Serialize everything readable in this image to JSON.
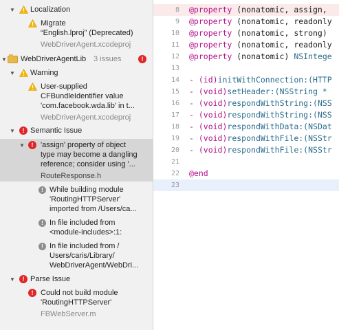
{
  "issue_navigator": {
    "localization_group": {
      "label": "Localization"
    },
    "localization_issue": {
      "line1": "Migrate",
      "line2": "“English.lproj” (Deprecated)",
      "file": "WebDriverAgent.xcodeproj"
    },
    "project": {
      "name": "WebDriverAgentLib",
      "count": "3 issues"
    },
    "warning_group": {
      "label": "Warning"
    },
    "warning_issue": {
      "line1": "User-supplied",
      "line2": "CFBundleIdentifier value",
      "line3": "'com.facebook.wda.lib' in t...",
      "file": "WebDriverAgent.xcodeproj"
    },
    "semantic_group": {
      "label": "Semantic Issue"
    },
    "semantic_issue": {
      "line1": "'assign' property of object",
      "line2": "type may become a dangling",
      "line3": "reference; consider using '...",
      "file": "RouteResponse.h"
    },
    "note1": {
      "line1": "While building module",
      "line2": "'RoutingHTTPServer'",
      "line3": "imported from /Users/ca..."
    },
    "note2": {
      "line1": "In file included from",
      "line2": "<module-includes>:1:"
    },
    "note3": {
      "line1": "In file included from /",
      "line2": "Users/caris/Library/",
      "line3": "WebDriverAgent/WebDri..."
    },
    "parse_group": {
      "label": "Parse Issue"
    },
    "parse_issue": {
      "line1": "Could not build module",
      "line2": "'RoutingHTTPServer'",
      "file": "FBWebServer.m"
    }
  },
  "editor": {
    "lines": [
      {
        "num": "8",
        "kw": "@property",
        "rest": " (nonatomic, assign,"
      },
      {
        "num": "9",
        "kw": "@property",
        "rest": " (nonatomic, readonly"
      },
      {
        "num": "10",
        "kw": "@property",
        "rest": " (nonatomic, strong)"
      },
      {
        "num": "11",
        "kw": "@property",
        "rest": " (nonatomic, readonly"
      },
      {
        "num": "12",
        "kw": "@property",
        "rest": " (nonatomic) ",
        "type": "NSIntege"
      },
      {
        "num": "13",
        "kw": "",
        "rest": ""
      },
      {
        "num": "14",
        "kw": "- ",
        "rest": "(id)",
        "type": "initWithConnection:(HTTP"
      },
      {
        "num": "15",
        "kw": "- ",
        "rest": "(void)",
        "type": "setHeader:(NSString *"
      },
      {
        "num": "16",
        "kw": "- ",
        "rest": "(void)",
        "type": "respondWithString:(NSS"
      },
      {
        "num": "17",
        "kw": "- ",
        "rest": "(void)",
        "type": "respondWithString:(NSS"
      },
      {
        "num": "18",
        "kw": "- ",
        "rest": "(void)",
        "type": "respondWithData:(NSDat"
      },
      {
        "num": "19",
        "kw": "- ",
        "rest": "(void)",
        "type": "respondWithFile:(NSStr"
      },
      {
        "num": "20",
        "kw": "- ",
        "rest": "(void)",
        "type": "respondWithFile:(NSStr"
      },
      {
        "num": "21",
        "kw": "",
        "rest": ""
      },
      {
        "num": "22",
        "kw": "@end",
        "rest": ""
      },
      {
        "num": "23",
        "kw": "",
        "rest": ""
      }
    ]
  }
}
